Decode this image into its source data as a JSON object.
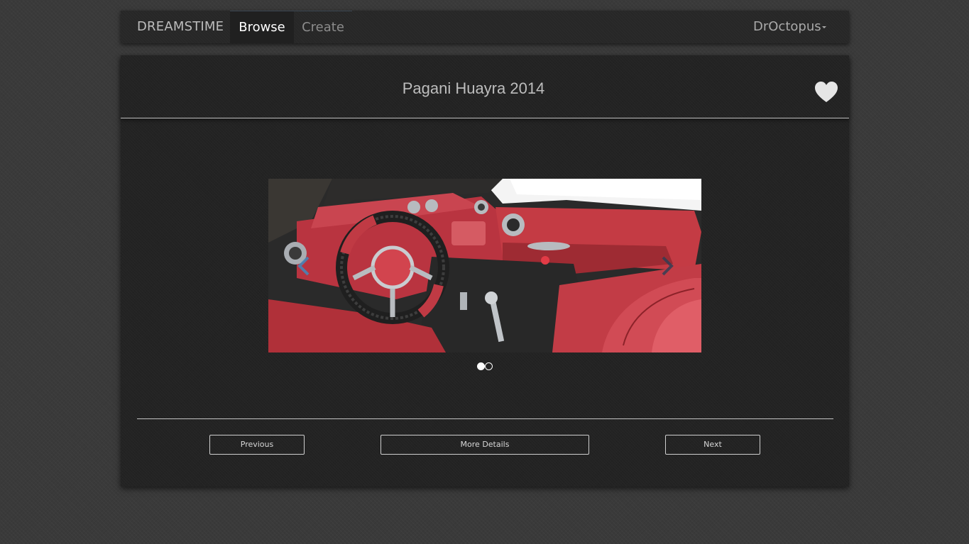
{
  "navbar": {
    "brand": "DREAMSTIME",
    "tabs": [
      {
        "label": "Browse",
        "active": true
      },
      {
        "label": "Create",
        "active": false
      }
    ],
    "user": "DrOctopus"
  },
  "item": {
    "title": "Pagani Huayra 2014",
    "favorite_icon": "heart-icon",
    "image": {
      "subject": "car interior",
      "colors": {
        "leather": "#c8383f",
        "carbon": "#2b2b2b",
        "metal": "#b8bcc0"
      }
    },
    "carousel": {
      "slide_count": 2,
      "active_slide": 1
    }
  },
  "actions": {
    "previous": "Previous",
    "details": "More Details",
    "next": "Next"
  },
  "colors": {
    "page_bg": "#3a3a3a",
    "panel_bg": "#232323",
    "text_muted": "#bdbdbd",
    "accent_line": "#3b4652"
  }
}
